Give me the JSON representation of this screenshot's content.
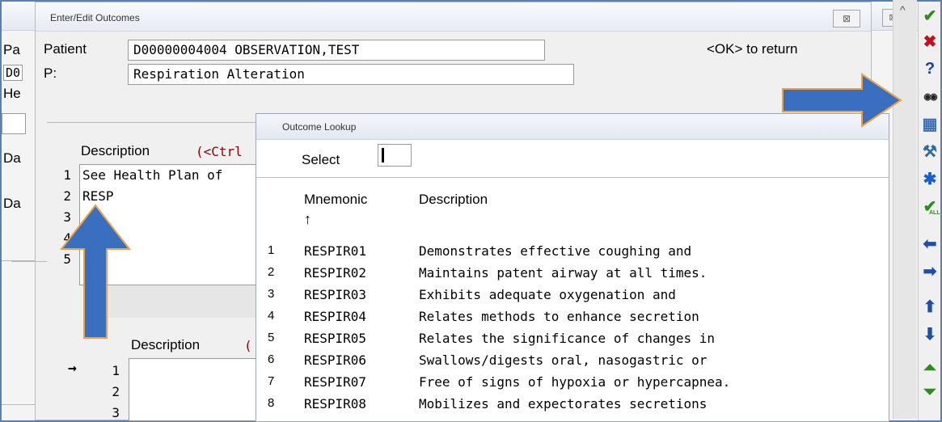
{
  "background_window": {
    "labels": [
      "Pa",
      "D0",
      "He",
      "Da",
      "Da"
    ],
    "close_glyph": "⊠"
  },
  "edit_window": {
    "title": "Enter/Edit Outcomes",
    "close_glyph": "⊠",
    "patient_label": "Patient",
    "patient_value": "D00000004004 OBSERVATION,TEST",
    "problem_label": "P:",
    "problem_value": "Respiration Alteration",
    "ok_hint": "<OK> to return",
    "description_label": "Description",
    "ctrl_hint": "(<Ctrl",
    "description_rows": [
      {
        "num": "1",
        "text": "See Health Plan of"
      },
      {
        "num": "2",
        "text": "RESP"
      },
      {
        "num": "3",
        "text": ""
      },
      {
        "num": "4",
        "text": ""
      },
      {
        "num": "5",
        "text": ""
      }
    ],
    "description2_label": "Description",
    "ctrl_hint2": "(",
    "description2_rows": [
      {
        "num": "1"
      },
      {
        "num": "2"
      },
      {
        "num": "3"
      }
    ],
    "row_pointer": "→"
  },
  "lookup": {
    "title": "Outcome Lookup",
    "select_label": "Select",
    "select_value": "",
    "col_mnemonic": "Mnemonic",
    "col_description": "Description",
    "sort_arrow": "↑",
    "rows": [
      {
        "idx": "1",
        "mnemonic": "RESPIR01",
        "description": "Demonstrates effective coughing and"
      },
      {
        "idx": "2",
        "mnemonic": "RESPIR02",
        "description": "Maintains patent airway at all times."
      },
      {
        "idx": "3",
        "mnemonic": "RESPIR03",
        "description": "Exhibits adequate oxygenation and"
      },
      {
        "idx": "4",
        "mnemonic": "RESPIR04",
        "description": "Relates methods to enhance secretion"
      },
      {
        "idx": "5",
        "mnemonic": "RESPIR05",
        "description": "Relates the significance of changes in"
      },
      {
        "idx": "6",
        "mnemonic": "RESPIR06",
        "description": "Swallows/digests oral, nasogastric or"
      },
      {
        "idx": "7",
        "mnemonic": "RESPIR07",
        "description": "Free of signs of hypoxia or hypercapnea."
      },
      {
        "idx": "8",
        "mnemonic": "RESPIR08",
        "description": "Mobilizes and expectorates secretions"
      }
    ]
  },
  "toolbar": {
    "buttons": [
      {
        "icon": "check-icon",
        "glyph": "✔",
        "color": "#2e8b1f"
      },
      {
        "icon": "cancel-x-icon",
        "glyph": "✖",
        "color": "#c0101a"
      },
      {
        "icon": "help-icon",
        "glyph": "?",
        "color": "#1d3f9a"
      },
      {
        "icon": "binoculars-icon",
        "glyph": "◉◉",
        "color": "#222222"
      },
      {
        "icon": "grid-edit-icon",
        "glyph": "▦",
        "color": "#3d6fb6"
      },
      {
        "icon": "tools-icon",
        "glyph": "⚒",
        "color": "#2e6b9a"
      },
      {
        "icon": "asterisk-icon",
        "glyph": "✱",
        "color": "#1a5fd0"
      },
      {
        "icon": "check-all-icon",
        "glyph": "✔",
        "color": "#2e8b1f"
      },
      {
        "icon": "arrow-left-icon",
        "glyph": "⬅",
        "color": "#1d4fa8"
      },
      {
        "icon": "arrow-right-icon",
        "glyph": "➡",
        "color": "#1d4fa8"
      },
      {
        "icon": "arrow-up-icon",
        "glyph": "⬆",
        "color": "#1d4fa8"
      },
      {
        "icon": "arrow-down-icon",
        "glyph": "⬇",
        "color": "#1d4fa8"
      },
      {
        "icon": "page-up-icon",
        "glyph": "⏶",
        "color": "#2e8b1f"
      },
      {
        "icon": "page-down-icon",
        "glyph": "⏷",
        "color": "#2e8b1f"
      }
    ],
    "all_badge": "ALL"
  },
  "colors": {
    "annotation_arrow": "#3a6fc0",
    "annotation_arrow_outline": "#f0a040",
    "ctrl_hint": "#8b0000"
  }
}
